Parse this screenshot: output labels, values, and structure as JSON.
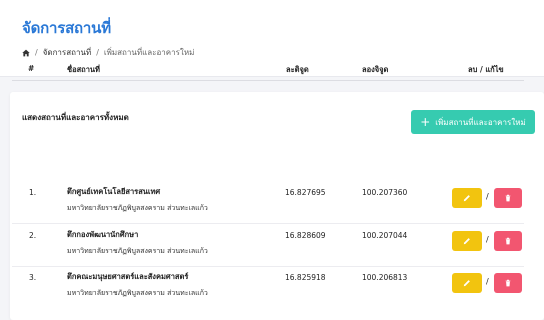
{
  "header": {
    "title": "จัดการสถานที่",
    "breadcrumb": {
      "items": [
        "จัดการสถานที่",
        "เพิ่มสถานที่และอาคารใหม่"
      ],
      "separator": "/"
    }
  },
  "card": {
    "title": "แสดงสถานที่และอาคารทั้งหมด",
    "add_button": {
      "icon": "+",
      "label": "เพิ่มสถานที่และอาคารใหม่"
    }
  },
  "table": {
    "columns": {
      "index": "#",
      "name": "ชื่อสถานที่",
      "lat": "ละติจูด",
      "lng": "ลองจิจูด",
      "actions": "ลบ / แก้ไข"
    },
    "rows": [
      {
        "index": "1.",
        "name": "ตึกศูนย์เทคโนโลยีสารสนเทศ",
        "subname": "มหาวิทยาลัยราชภัฏพิบูลสงคราม ส่วนทะเลแก้ว",
        "lat": "16.827695",
        "lng": "100.207360",
        "slash": "/"
      },
      {
        "index": "2.",
        "name": "ตึกกองพัฒนานักศึกษา",
        "subname": "มหาวิทยาลัยราชภัฏพิบูลสงคราม ส่วนทะเลแก้ว",
        "lat": "16.828609",
        "lng": "100.207044",
        "slash": "/"
      },
      {
        "index": "3.",
        "name": "ตึกคณะมนุษยศาสตร์และสังคมศาสตร์",
        "subname": "มหาวิทยาลัยราชภัฏพิบูลสงคราม ส่วนทะเลแก้ว",
        "lat": "16.825918",
        "lng": "100.206813",
        "slash": "/"
      }
    ]
  },
  "colors": {
    "title": "#2a78d6",
    "add_button": "#36cbb0",
    "edit_button": "#f2c40f",
    "delete_button": "#f25670"
  },
  "icons": {
    "home": "home-icon",
    "edit": "pencil-icon",
    "delete": "trash-icon"
  }
}
